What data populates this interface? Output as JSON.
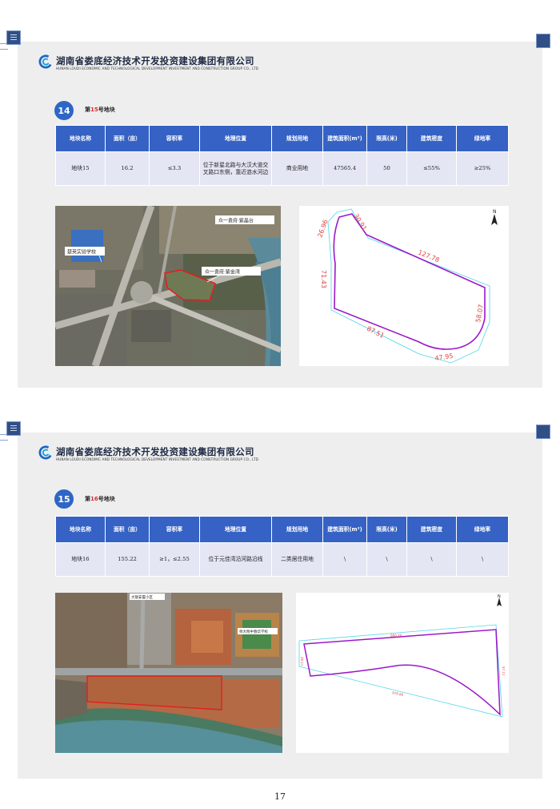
{
  "company": {
    "name_cn": "湖南省娄底经济技术开发投资建设集团有限公司",
    "name_en": "HUNAN LOUDI ECONOMIC AND TECHNOLOGICAL DEVELOPMENT INVESTMENT AND CONSTRUCTION GROUP CO., LTD",
    "brand_color": "#2e66c6"
  },
  "slides": [
    {
      "badge": "14",
      "title_prefix": "第",
      "title_num": "15",
      "title_suffix": "号地块",
      "headers": [
        "地块名称",
        "面积（亩）",
        "容积率",
        "地理位置",
        "规划用地",
        "建筑面积(m²)",
        "限高(米)",
        "建筑密度",
        "绿地率"
      ],
      "row": [
        "地块15",
        "16.2",
        "≤3.3",
        "位于新星北路与大汉大道交叉路口东侧，靠近涟水河边",
        "商业用地",
        "47565.4",
        "50",
        "≤55%",
        "≥25%"
      ],
      "aerial_labels": [
        "众一贵府·紫晶台",
        "楚英实验学校",
        "众一贵府·紫金湾"
      ],
      "plan": {
        "north": "N",
        "dims": [
          "30.91",
          "26.96",
          "127.78",
          "71.43",
          "58.07",
          "87.51",
          "47.95"
        ]
      }
    },
    {
      "badge": "15",
      "title_prefix": "第",
      "title_num": "16",
      "title_suffix": "号地块",
      "headers": [
        "地块名称",
        "面积（亩）",
        "容积率",
        "地理位置",
        "规划用地",
        "建筑面积(m²)",
        "限高(米)",
        "建筑密度",
        "绿地率"
      ],
      "row": [
        "地块16",
        "155.22",
        "≥1，≤2.55",
        "位于元佳湾沿河路沿线",
        "二类居住用地",
        "\\",
        "\\",
        "\\",
        "\\"
      ],
      "aerial_labels": [
        "大联安置小区",
        "师大附中春华学校"
      ],
      "plan": {
        "north": "N",
        "dims": [
          "660.39",
          "57.11",
          "29.11",
          "878.86"
        ]
      }
    }
  ],
  "page_number": "17"
}
